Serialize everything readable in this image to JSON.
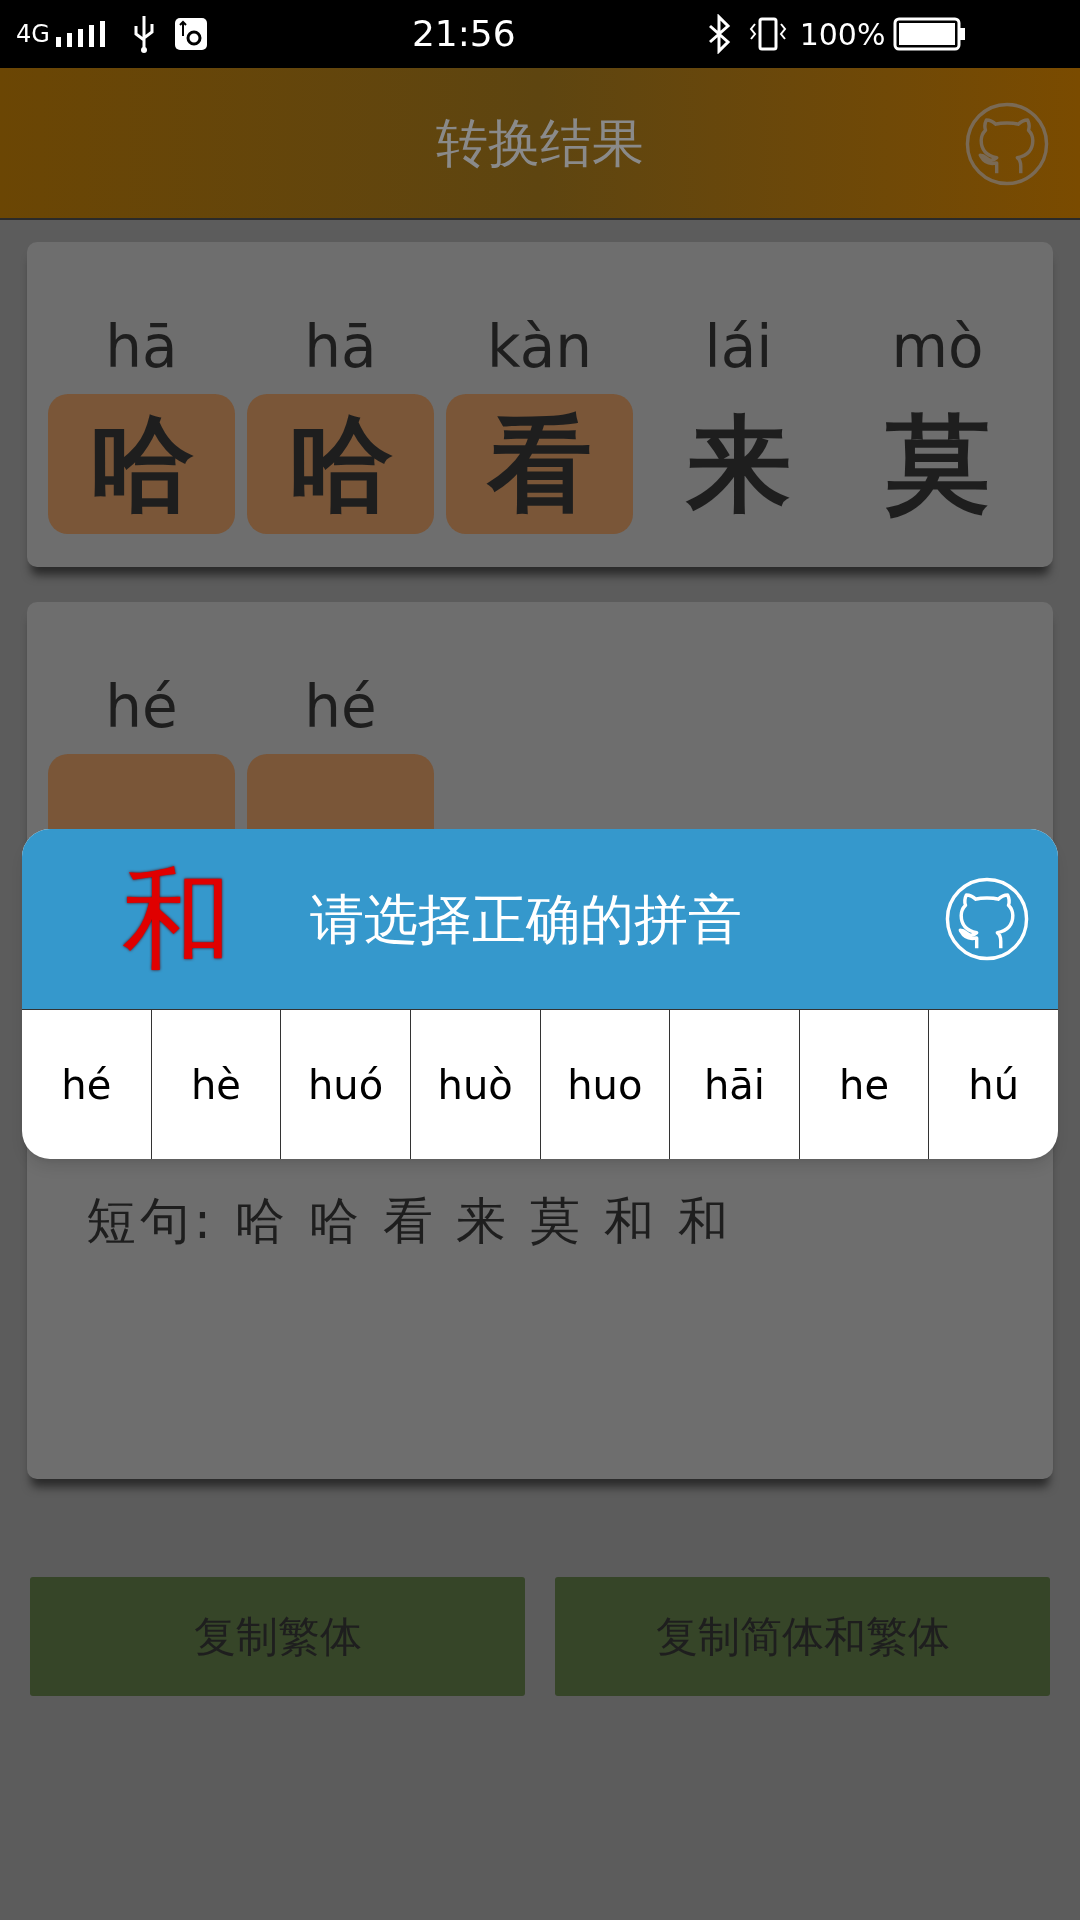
{
  "status_bar": {
    "network": "4G",
    "time": "21:56",
    "battery": "100%"
  },
  "header": {
    "title": "转换结果"
  },
  "cards": [
    {
      "items": [
        {
          "pinyin": "hā",
          "char": "哈",
          "highlighted": true
        },
        {
          "pinyin": "hā",
          "char": "哈",
          "highlighted": true
        },
        {
          "pinyin": "kàn",
          "char": "看",
          "highlighted": true
        },
        {
          "pinyin": "lái",
          "char": "来",
          "highlighted": false
        },
        {
          "pinyin": "mò",
          "char": "莫",
          "highlighted": false
        }
      ]
    },
    {
      "items": [
        {
          "pinyin": "hé",
          "highlighted": true
        },
        {
          "pinyin": "hé",
          "highlighted": true
        }
      ],
      "sentence": "短句: 哈 哈 看 来 莫 和 和"
    }
  ],
  "dialog": {
    "char": "和",
    "title": "请选择正确的拼音",
    "options": [
      "hé",
      "hè",
      "huó",
      "huò",
      "huo",
      "hāi",
      "he",
      "hú"
    ]
  },
  "buttons": [
    "复制繁体",
    "复制简体和繁体"
  ]
}
